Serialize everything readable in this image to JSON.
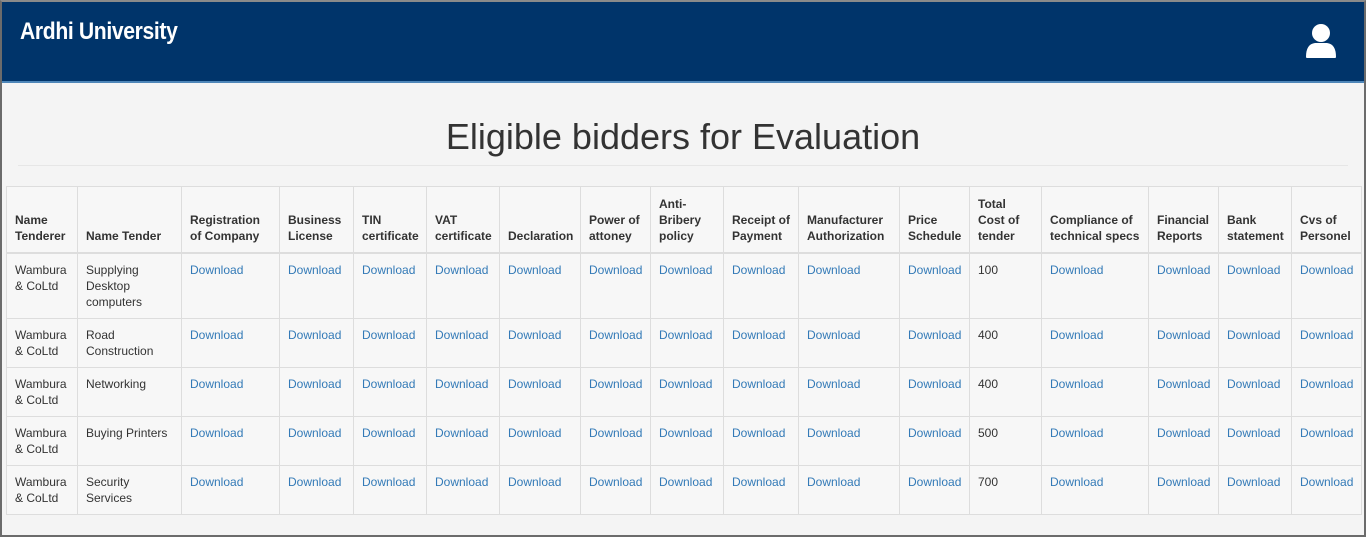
{
  "navbar": {
    "brand": "Ardhi University",
    "user_icon": "user-icon",
    "bg_color": "#00346a"
  },
  "main": {
    "title": "Eligible bidders for Evaluation"
  },
  "table": {
    "headers": [
      "Name Tenderer",
      "Name Tender",
      "Registration of Company",
      "Business License",
      "TIN certificate",
      "VAT certificate",
      "Declaration",
      "Power of attoney",
      "Anti-Bribery policy",
      "Receipt of Payment",
      "Manufacturer Authorization",
      "Price Schedule",
      "Total Cost of tender",
      "Compliance of technical specs",
      "Financial Reports",
      "Bank statement",
      "Cvs of Personel"
    ],
    "link_label": "Download",
    "rows": [
      {
        "tenderer": "Wambura & CoLtd",
        "tender": "Supplying Desktop computers",
        "cost": "100"
      },
      {
        "tenderer": "Wambura & CoLtd",
        "tender": "Road Construction",
        "cost": "400"
      },
      {
        "tenderer": "Wambura & CoLtd",
        "tender": "Networking",
        "cost": "400"
      },
      {
        "tenderer": "Wambura & CoLtd",
        "tender": "Buying Printers",
        "cost": "500"
      },
      {
        "tenderer": "Wambura & CoLtd",
        "tender": "Security Services",
        "cost": "700"
      }
    ]
  }
}
